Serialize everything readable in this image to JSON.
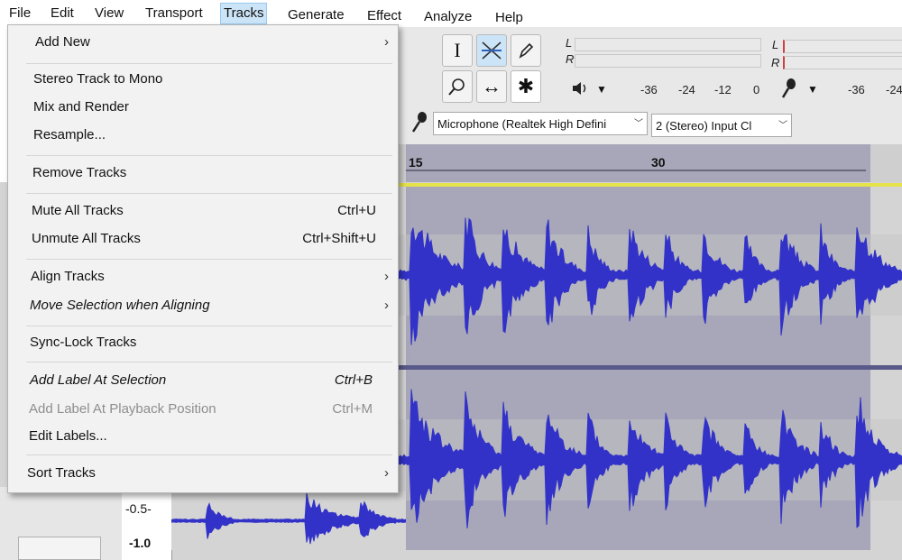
{
  "menubar": {
    "items": [
      {
        "label": "File"
      },
      {
        "label": "Edit"
      },
      {
        "label": "View"
      },
      {
        "label": "Transport"
      },
      {
        "label": "Tracks"
      },
      {
        "label": "Generate"
      },
      {
        "label": "Effect"
      },
      {
        "label": "Analyze"
      },
      {
        "label": "Help"
      }
    ],
    "active": "Tracks"
  },
  "tracks_menu": {
    "items": [
      {
        "label": "Add New",
        "shortcut": "",
        "submenu": true
      },
      {
        "label": "Stereo Track to Mono",
        "shortcut": ""
      },
      {
        "label": "Mix and Render",
        "shortcut": ""
      },
      {
        "label": "Resample...",
        "shortcut": ""
      },
      {
        "label": "Remove Tracks",
        "shortcut": ""
      },
      {
        "label": "Mute All Tracks",
        "shortcut": "Ctrl+U"
      },
      {
        "label": "Unmute All Tracks",
        "shortcut": "Ctrl+Shift+U"
      },
      {
        "label": "Align Tracks",
        "shortcut": "",
        "submenu": true
      },
      {
        "label": "Move Selection when Aligning",
        "shortcut": "",
        "submenu": true
      },
      {
        "label": "Sync-Lock Tracks",
        "shortcut": ""
      },
      {
        "label": "Add Label At Selection",
        "shortcut": "Ctrl+B"
      },
      {
        "label": "Add Label At Playback Position",
        "shortcut": "Ctrl+M",
        "disabled": true
      },
      {
        "label": "Edit Labels...",
        "shortcut": ""
      },
      {
        "label": "Sort Tracks",
        "shortcut": "",
        "submenu": true
      }
    ],
    "submenu_glyph": "›"
  },
  "toolbar": {
    "tools": {
      "selection": "I",
      "envelope": "envelope-icon",
      "draw": "pencil-icon",
      "zoom": "zoom-icon",
      "timeshift": "↔",
      "multi": "✱"
    },
    "playback_meter": {
      "left": "L",
      "right": "R"
    },
    "record_meter": {
      "left": "L",
      "right": "R"
    },
    "meter_scale": [
      "-36",
      "-24",
      "-12",
      "0"
    ],
    "meter_scale_right": [
      "-36",
      "-24"
    ],
    "device": {
      "input": "Microphone (Realtek High Defini",
      "channels": "2 (Stereo) Input Cl"
    }
  },
  "ruler": {
    "ticks": [
      "15",
      "30"
    ]
  },
  "track": {
    "scale_label": "-0.5-",
    "scale_label_partial": "-1.0"
  },
  "colors": {
    "menu_bg": "#f2f2f2",
    "menubar_active": "#cce4f7",
    "waveform": "#3232c8",
    "selection": "#a7a7b9",
    "track_bg": "#d4d4d4"
  }
}
